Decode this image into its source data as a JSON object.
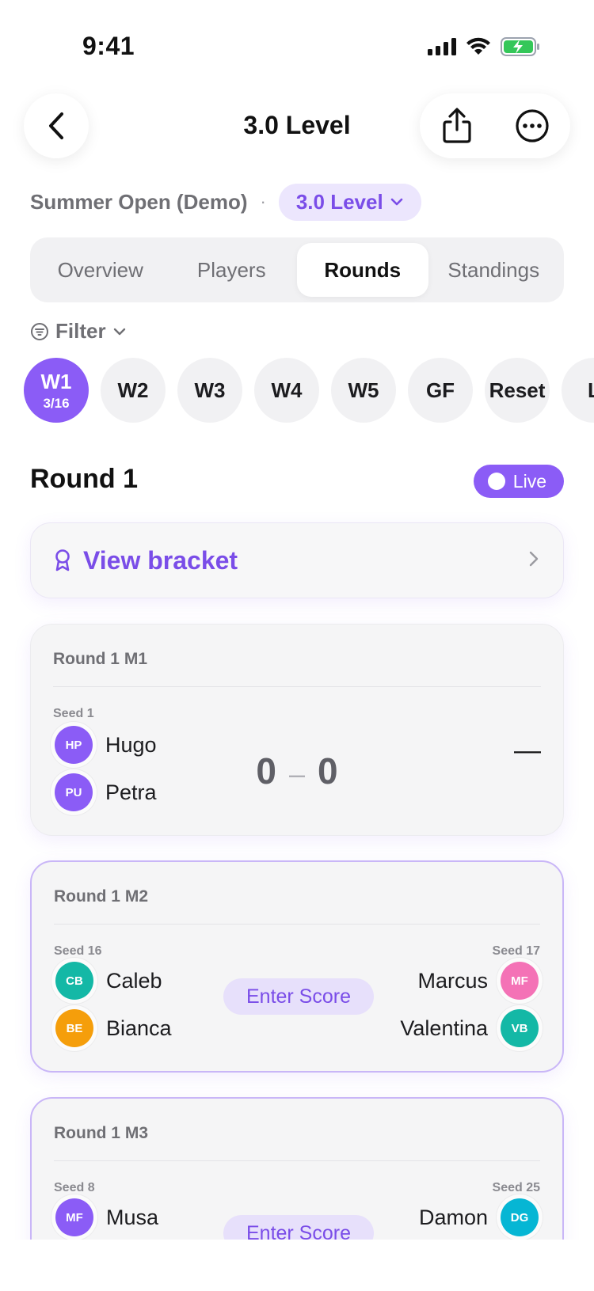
{
  "status": {
    "time": "9:41"
  },
  "nav": {
    "title": "3.0 Level"
  },
  "context": {
    "event": "Summer Open (Demo)",
    "separator": "·",
    "level": "3.0 Level"
  },
  "tabs": [
    {
      "label": "Overview"
    },
    {
      "label": "Players"
    },
    {
      "label": "Rounds",
      "active": true
    },
    {
      "label": "Standings"
    }
  ],
  "filter": {
    "label": "Filter"
  },
  "weeks": [
    {
      "label": "W1",
      "sub": "3/16",
      "active": true
    },
    {
      "label": "W2"
    },
    {
      "label": "W3"
    },
    {
      "label": "W4"
    },
    {
      "label": "W5"
    },
    {
      "label": "GF"
    },
    {
      "label": "Reset"
    },
    {
      "label": "L"
    }
  ],
  "round": {
    "title": "Round 1",
    "live_label": "Live"
  },
  "bracket": {
    "label": "View bracket"
  },
  "matches": [
    {
      "title": "Round 1 M1",
      "left_seed": "Seed 1",
      "left_players": [
        {
          "initials": "HP",
          "name": "Hugo",
          "color": "#8b5cf6"
        },
        {
          "initials": "PU",
          "name": "Petra",
          "color": "#8b5cf6"
        }
      ],
      "score_left": "0",
      "score_sep": "–",
      "score_right": "0",
      "right_value": "—"
    },
    {
      "title": "Round 1 M2",
      "left_seed": "Seed 16",
      "right_seed": "Seed 17",
      "left_players": [
        {
          "initials": "CB",
          "name": "Caleb",
          "color": "#14b8a6"
        },
        {
          "initials": "BE",
          "name": "Bianca",
          "color": "#f59e0b"
        }
      ],
      "right_players": [
        {
          "initials": "MF",
          "name": "Marcus",
          "color": "#f472b6"
        },
        {
          "initials": "VB",
          "name": "Valentina",
          "color": "#14b8a6"
        }
      ],
      "action": "Enter Score"
    },
    {
      "title": "Round 1 M3",
      "left_seed": "Seed 8",
      "right_seed": "Seed 25",
      "left_players": [
        {
          "initials": "MF",
          "name": "Musa",
          "color": "#8b5cf6"
        }
      ],
      "right_players": [
        {
          "initials": "DG",
          "name": "Damon",
          "color": "#06b6d4"
        }
      ],
      "action": "Enter Score"
    }
  ]
}
